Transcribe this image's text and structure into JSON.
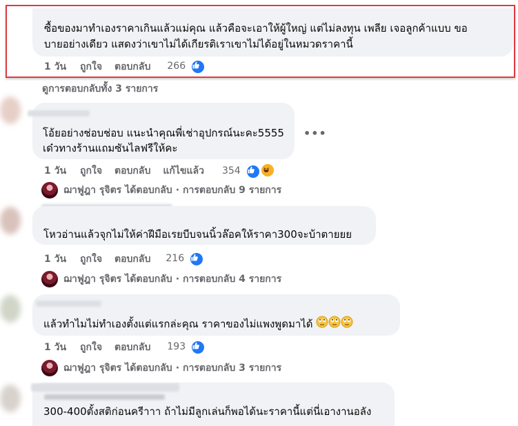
{
  "comments": [
    {
      "text_lines": [
        "ซื้อของมาทำเองราคาเกินแล้วแม่คุณ แล้วคือจะเอาให้ผู้ใหญ่ แต่ไม่ลงทุน เพลีย เจอลูกค้าแบบ ขอ",
        "บายอย่างเดียว แสดงว่าเขาไม่ได้เกียรติเราเขาไม่ได้อยู่ในหมวดราคานี้"
      ],
      "time": "1 วัน",
      "like": "ถูกใจ",
      "reply": "ตอบกลับ",
      "count": "266"
    },
    {
      "text_lines": [
        "โอ้ยอย่างช่อบช่อบ แนะนำคุณพี่เช่าอุปกรณ์นะคะ5555",
        "เด๋วทางร้านแถมซันไลฟรีให้คะ"
      ],
      "time": "1 วัน",
      "like": "ถูกใจ",
      "reply": "ตอบกลับ",
      "edited": "แก้ไขแล้ว",
      "count": "354"
    },
    {
      "text_lines": [
        "โหวอ่านแล้วจุกไม่ให้ค่าฝีมือเรยบีบจนนิ้วล๊อคให้ราคา300จะบ้าตายยย"
      ],
      "time": "1 วัน",
      "like": "ถูกใจ",
      "reply": "ตอบกลับ",
      "count": "216"
    },
    {
      "text_lines": [
        "แล้วทำไมไม่ทำเองตั้งแต่แรกล่ะคุณ ราคาของไม่แพงพูดมาได้"
      ],
      "time": "1 วัน",
      "like": "ถูกใจ",
      "reply": "ตอบกลับ",
      "count": "193"
    },
    {
      "text_lines": [
        "300-400ตั้งสติก่อนครีาาา ถ้าไม่มีลูกเล่นก็พอได้นะราคานี้แต่นี่เอางานอลัง"
      ]
    }
  ],
  "view_replies": "ดูการตอบกลับทั้ง 3 รายการ",
  "reply_summaries": [
    {
      "name": "ฌาฟูฎา รุจิตร",
      "action": "ได้ตอบกลับ",
      "sep": "·",
      "count_text": "การตอบกลับ 9 รายการ"
    },
    {
      "name": "ฌาฟูฎา รุจิตร",
      "action": "ได้ตอบกลับ",
      "sep": "·",
      "count_text": "การตอบกลับ 4 รายการ"
    },
    {
      "name": "ฌาฟูฎา รุจิตร",
      "action": "ได้ตอบกลับ",
      "sep": "·",
      "count_text": "การตอบกลับ 3 รายการ"
    }
  ],
  "icons": {
    "like": "like-icon",
    "haha": "haha-icon",
    "more": "more-options-icon",
    "rolling_eyes": "rolling-eyes-emoji"
  },
  "colors": {
    "bubble": "#f0f2f5",
    "meta": "#65676b",
    "like_blue": "#2078f4",
    "highlight_red": "#e0393e"
  }
}
